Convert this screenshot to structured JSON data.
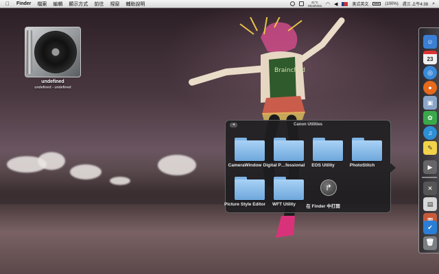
{
  "menubar": {
    "apple": "",
    "items": [
      "Finder",
      "檔案",
      "編輯",
      "顯示方式",
      "前往",
      "視窗",
      "輔助說明"
    ],
    "status": {
      "weather_temp": "41°C",
      "weather_city": "Hiroshima",
      "input_method": "美式英文",
      "battery": "(100%)",
      "clock": "週三 上午4:38"
    }
  },
  "desktop": {
    "disc_title": "undefined",
    "disc_subtitle": "undefined - undefined"
  },
  "stack": {
    "title": "Canon Utilities",
    "back_glyph": "◂",
    "items": [
      {
        "label": "CameraWindow",
        "icon": "folder-icon"
      },
      {
        "label": "Digital P…fessional",
        "icon": "folder-icon"
      },
      {
        "label": "EOS Utility",
        "icon": "folder-icon"
      },
      {
        "label": "PhotoStitch",
        "icon": "folder-icon"
      },
      {
        "label": "Picture Style Editor",
        "icon": "folder-icon"
      },
      {
        "label": "WFT Utility",
        "icon": "folder-icon"
      },
      {
        "label": "在 Finder 中打開",
        "icon": "open-in-finder-icon"
      }
    ],
    "open_glyph": "↱"
  },
  "dock": {
    "calendar_day": "23",
    "items": [
      {
        "name": "finder",
        "glyph": "☺",
        "color": "#3b7fd4"
      },
      {
        "name": "ical",
        "glyph": "23",
        "color": "#e9e9e9"
      },
      {
        "name": "safari",
        "glyph": "◎",
        "color": "#3a8ad8"
      },
      {
        "name": "firefox",
        "glyph": "●",
        "color": "#e56a1c"
      },
      {
        "name": "preview",
        "glyph": "▣",
        "color": "#8aa6c8"
      },
      {
        "name": "app-green",
        "glyph": "✿",
        "color": "#3aa84a"
      },
      {
        "name": "itunes",
        "glyph": "♫",
        "color": "#2d8fd6"
      },
      {
        "name": "stickies",
        "glyph": "✎",
        "color": "#f2d24a"
      },
      {
        "name": "stack-canon",
        "glyph": "▶",
        "color": "#666666"
      },
      {
        "name": "utilities",
        "glyph": "✕",
        "color": "#555555"
      },
      {
        "name": "text-app",
        "glyph": "▤",
        "color": "#d8d8d8"
      },
      {
        "name": "photo-app",
        "glyph": "▦",
        "color": "#c85a3a"
      },
      {
        "name": "app-check",
        "glyph": "✔",
        "color": "#2a7ed6"
      },
      {
        "name": "trash",
        "glyph": "🗑",
        "color": "#7b7f84"
      }
    ]
  }
}
